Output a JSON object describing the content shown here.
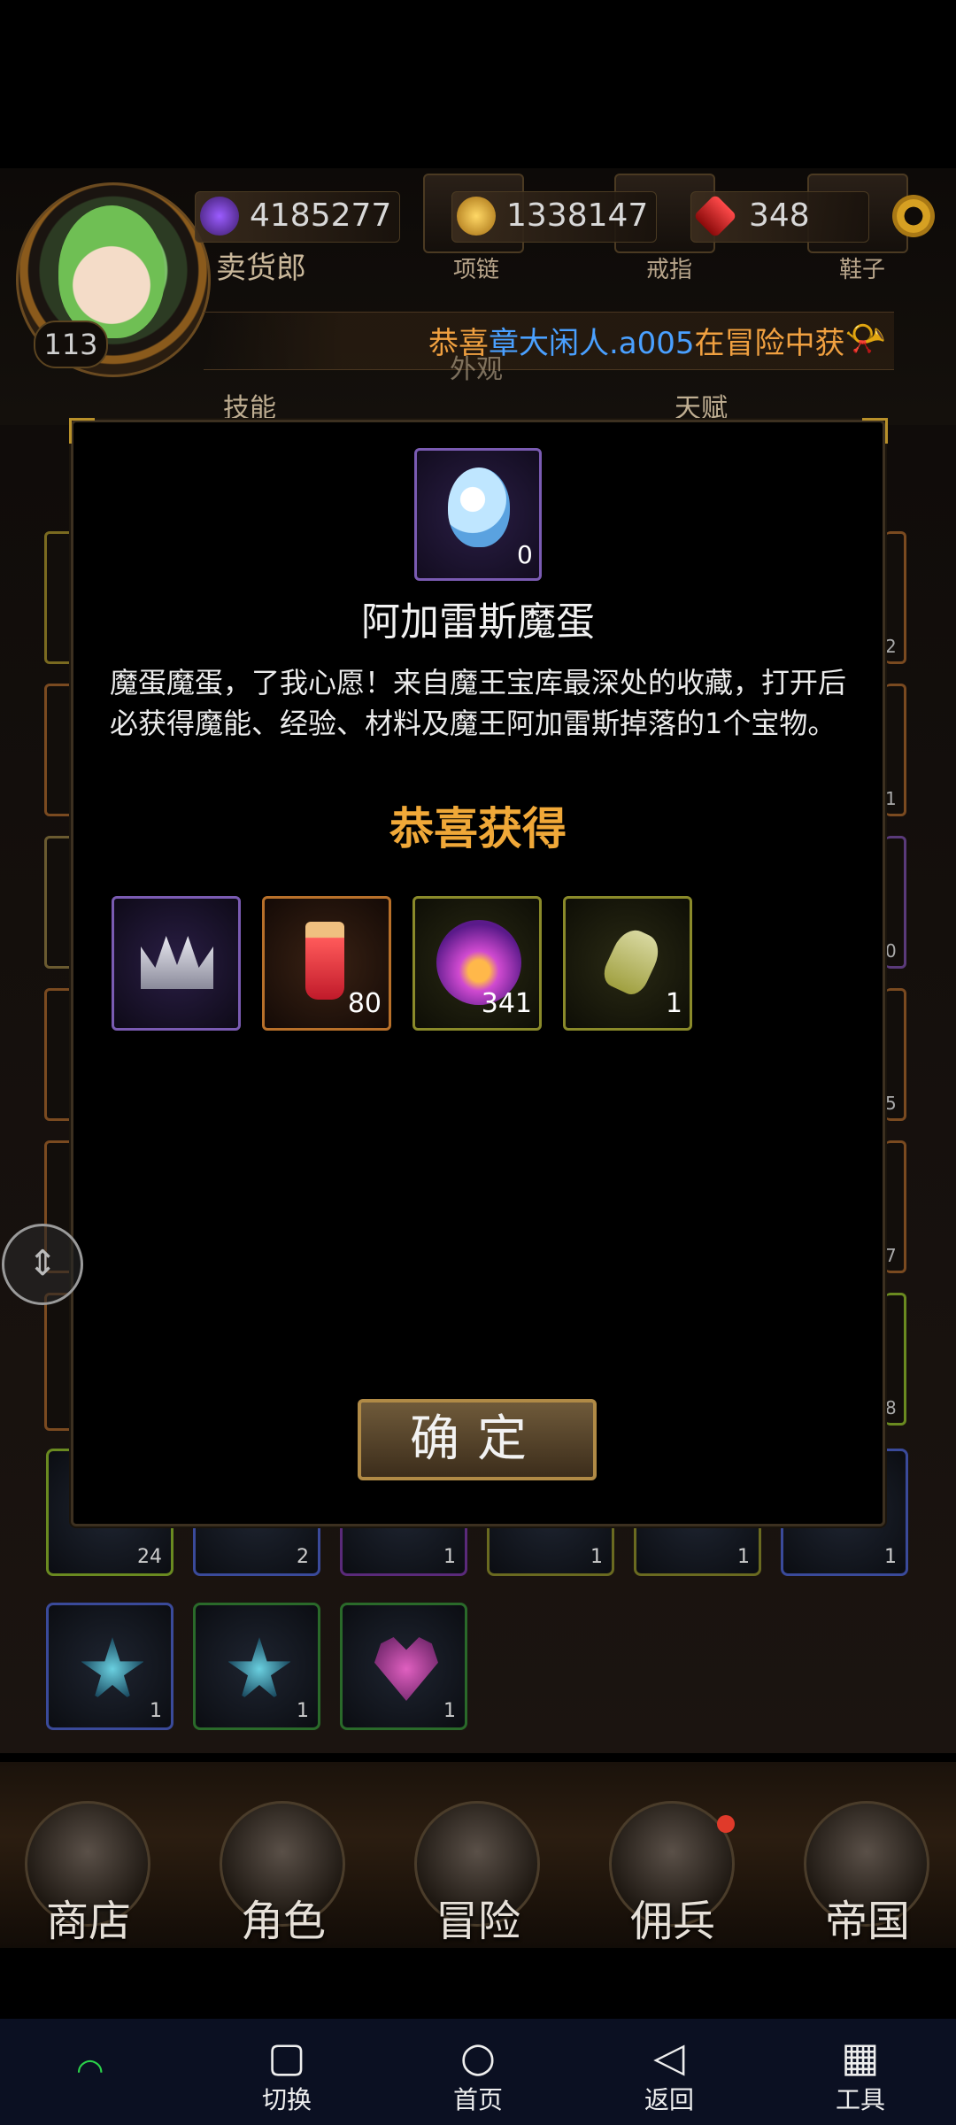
{
  "hud": {
    "player_name": "卖货郎",
    "level": "113",
    "currency_a": "4185277",
    "currency_b": "1338147",
    "currency_c": "348",
    "equip_labels": [
      "项链",
      "戒指",
      "鞋子"
    ],
    "tab_labels": [
      "技能",
      "外观",
      "天赋"
    ],
    "ticker": {
      "prefix": "恭喜",
      "player": "章大闲人.a005",
      "suffix": "在冒险中获"
    }
  },
  "side_slots": [
    "2",
    "1",
    "0",
    "5",
    "7",
    "8"
  ],
  "inventory_row1": [
    "24",
    "2",
    "1",
    "1",
    "1",
    "1"
  ],
  "inventory_row2": [
    {
      "icon": "blue-star-gem-icon",
      "count": "1"
    },
    {
      "icon": "blue-star-gem-icon",
      "count": "1"
    },
    {
      "icon": "purple-heart-gem-icon",
      "count": "1"
    }
  ],
  "modal": {
    "item_icon": "agares-egg-icon",
    "item_count": "0",
    "item_name": "阿加雷斯魔蛋",
    "description": "魔蛋魔蛋，了我心愿！来自魔王宝库最深处的收藏，打开后必获得魔能、经验、材料及魔王阿加雷斯掉落的1个宝物。",
    "congrats": "恭喜获得",
    "rewards": [
      {
        "icon": "silver-crown-icon",
        "count": ""
      },
      {
        "icon": "red-drink-icon",
        "count": "80"
      },
      {
        "icon": "purple-fire-orb-icon",
        "count": "341"
      },
      {
        "icon": "potion-flask-icon",
        "count": "1"
      }
    ],
    "confirm_label": "确定"
  },
  "game_nav": [
    "商店",
    "角色",
    "冒险",
    "佣兵",
    "帝国"
  ],
  "system_nav": [
    {
      "icon": "square-icon",
      "label": "切换"
    },
    {
      "icon": "circle-icon",
      "label": "首页"
    },
    {
      "icon": "back-triangle-icon",
      "label": "返回"
    },
    {
      "icon": "grid-icon",
      "label": "工具"
    }
  ],
  "colors": {
    "accent_gold": "#f0a838",
    "ticker_orange": "#f0a040",
    "ticker_blue": "#4aa0ff",
    "modal_border": "#3c3020"
  }
}
